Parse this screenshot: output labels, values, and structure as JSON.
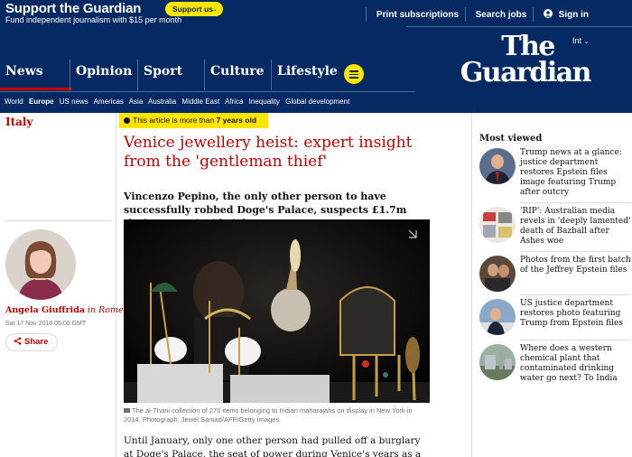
{
  "support": {
    "title": "Support the Guardian",
    "subtitle": "Fund independent journalism with $15 per month",
    "button": "Support us",
    "button_arrow": "→"
  },
  "top_links": {
    "print": "Print subscriptions",
    "jobs": "Search jobs",
    "signin": "Sign in"
  },
  "edition": "Int",
  "logo": {
    "line1": "The",
    "line2": "Guardian"
  },
  "pillars": [
    "News",
    "Opinion",
    "Sport",
    "Culture",
    "Lifestyle"
  ],
  "subnav": [
    "World",
    "Europe",
    "US news",
    "Americas",
    "Asia",
    "Australia",
    "Middle East",
    "Africa",
    "Inequality",
    "Global development"
  ],
  "subnav_current": "Europe",
  "section": "Italy",
  "age_warning": {
    "text": "This article is more than ",
    "bold": "7 years old"
  },
  "headline": "Venice jewellery heist: expert insight from the 'gentleman thief'",
  "standfirst": "Vincenzo Pepino, the only other person to have successfully robbed Doge's Palace, suspects £1.7m theft was an inside job",
  "caption": "The al-Thani collection of 270 items belonging to Indian maharajahs on display in New York in 2014. Photograph: Jewel Samad/AFP/Getty Images",
  "body_text": "Until January, only one other person had pulled off a burglary at Doge's Palace, the seat of power during Venice's years as a republic, and a museum",
  "author": {
    "name": "Angela Giuffrida",
    "location": "in Rome"
  },
  "pubdate": "Sat 17 Nov 2018 05.00 GMT",
  "share_label": "Share",
  "most_viewed": {
    "title": "Most viewed",
    "items": [
      "Trump news at a glance: justice department restores Epstein files image featuring Trump after outcry",
      "'RIP': Australian media revels in 'deeply lamented' death of Bazball after Ashes woe",
      "Photos from the first batch of the Jeffrey Epstein files",
      "US justice department restores photo featuring Trump from Epstein files",
      "Where does a western chemical plant that contaminated drinking water go next? To India"
    ]
  },
  "colors": {
    "brand": "#052962",
    "accent": "#c70000",
    "yellow": "#ffe500"
  }
}
